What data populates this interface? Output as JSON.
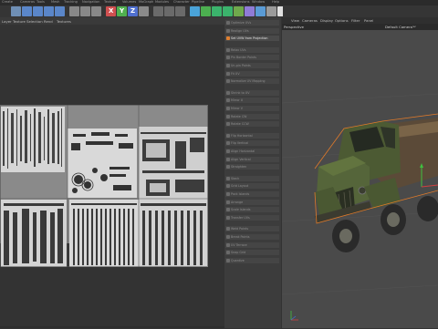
{
  "menubar": {
    "items": [
      "Create",
      "Cameras",
      "Tools",
      "Mesh",
      "Tracking",
      "Navigation",
      "Texture",
      "Volumes",
      "MoGraph",
      "Modules",
      "Character",
      "Pipeline",
      "Plugins",
      "Extensions",
      "Window",
      "Help"
    ]
  },
  "toolbar": {
    "icons": [
      {
        "name": "undo-icon",
        "color": "#6f8fb5"
      },
      {
        "name": "move-icon",
        "color": "#5a86c9"
      },
      {
        "name": "scale-icon",
        "color": "#5a86c9"
      },
      {
        "name": "rotate-icon",
        "color": "#5a86c9"
      },
      {
        "name": "live-select-icon",
        "color": "#5a86c9"
      },
      {
        "name": "poly-icon",
        "color": "#888888"
      },
      {
        "name": "points-icon",
        "color": "#888888"
      },
      {
        "name": "edges-icon",
        "color": "#888888"
      },
      {
        "name": "x-axis-icon",
        "color": "#d05050",
        "label": "X"
      },
      {
        "name": "y-axis-icon",
        "color": "#50b050",
        "label": "Y"
      },
      {
        "name": "z-axis-icon",
        "color": "#5070d0",
        "label": "Z"
      },
      {
        "name": "coords-icon",
        "color": "#8a8a8a"
      },
      {
        "name": "render-view-icon",
        "color": "#6a6a6a"
      },
      {
        "name": "render-icon",
        "color": "#6a6a6a"
      },
      {
        "name": "render-settings-icon",
        "color": "#6a6a6a"
      },
      {
        "name": "cube-icon",
        "color": "#4aa3d8"
      },
      {
        "name": "spline-icon",
        "color": "#4caf50"
      },
      {
        "name": "nurbs-icon",
        "color": "#3bb36c"
      },
      {
        "name": "cloner-icon",
        "color": "#3bb36c"
      },
      {
        "name": "deformer-icon",
        "color": "#6fa84c"
      },
      {
        "name": "field-icon",
        "color": "#8f7bd6"
      },
      {
        "name": "scene-icon",
        "color": "#5a9bd5"
      },
      {
        "name": "camera-icon",
        "color": "#9a9a9a"
      },
      {
        "name": "light-icon",
        "color": "#e0e0e0"
      }
    ]
  },
  "uv_panel": {
    "menu": [
      "Layer",
      "Texture Selection",
      "Rend",
      "Textures"
    ]
  },
  "commands": {
    "items": [
      {
        "label": "Optimize UVs",
        "active": false
      },
      {
        "label": "Realign UVs",
        "active": false
      },
      {
        "label": "Set UVW from Projection",
        "active": true
      },
      {
        "label": "Relax UVs",
        "active": false
      },
      {
        "label": "Pin Border Points",
        "active": false
      },
      {
        "label": "Un-pin Points",
        "active": false
      },
      {
        "label": "Fit UV",
        "active": false
      },
      {
        "label": "Normalize UV Mapping",
        "active": false
      },
      {
        "label": "Shrink to UV",
        "active": false
      },
      {
        "label": "Mirror U",
        "active": false
      },
      {
        "label": "Mirror V",
        "active": false
      },
      {
        "label": "Rotate CW",
        "active": false
      },
      {
        "label": "Rotate CCW",
        "active": false
      },
      {
        "label": "Flip Horizontal",
        "active": false
      },
      {
        "label": "Flip Vertical",
        "active": false
      },
      {
        "label": "Align Horizontal",
        "active": false
      },
      {
        "label": "Align Vertical",
        "active": false
      },
      {
        "label": "Straighten",
        "active": false
      },
      {
        "label": "Stack",
        "active": false
      },
      {
        "label": "Grid Layout",
        "active": false
      },
      {
        "label": "Pack Islands",
        "active": false
      },
      {
        "label": "Arrange",
        "active": false
      },
      {
        "label": "Scale Islands",
        "active": false
      },
      {
        "label": "Transfer UVs",
        "active": false
      },
      {
        "label": "Weld Points",
        "active": false
      },
      {
        "label": "Break Points",
        "active": false
      },
      {
        "label": "UV Terrace",
        "active": false
      },
      {
        "label": "Snap Grid",
        "active": false
      },
      {
        "label": "Quantize",
        "active": false
      }
    ]
  },
  "viewport": {
    "menu": [
      "View",
      "Cameras",
      "Display",
      "Options",
      "Filter",
      "Panel"
    ],
    "label": "Perspective",
    "camera": "Default Camera'*'",
    "colors": {
      "background": "#4a4a4a",
      "cab": "#4c5a33",
      "selection": "#e07a2a"
    }
  }
}
